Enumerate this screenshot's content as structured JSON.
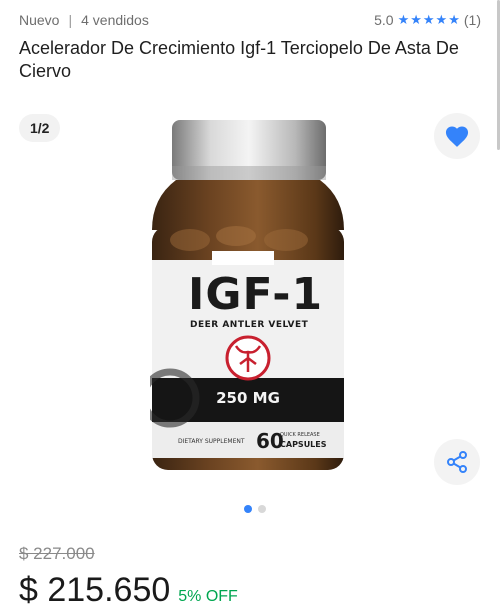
{
  "meta": {
    "condition": "Nuevo",
    "separator": "|",
    "sold": "4 vendidos",
    "rating": "5.0",
    "stars": "★★★★★",
    "reviews": "(1)"
  },
  "product": {
    "title": "Acelerador De Crecimiento Igf-1 Terciopelo De Asta De Ciervo",
    "image_counter": "1/2",
    "label": {
      "name": "IGF-1",
      "subtitle": "DEER ANTLER VELVET",
      "dose": "250 MG",
      "supplement": "DIETARY SUPPLEMENT",
      "count": "60",
      "count_desc_1": "QUICK RELEASE",
      "count_desc_2": "CAPSULES"
    }
  },
  "gallery": {
    "total": 2,
    "active": 1
  },
  "pricing": {
    "old_price": "$ 227.000",
    "price": "$ 215.650",
    "discount": "5% OFF"
  },
  "icons": {
    "favorite": "heart-icon",
    "share": "share-icon"
  },
  "colors": {
    "accent": "#3483fa",
    "discount": "#00a650",
    "label_red": "#c8202f"
  }
}
